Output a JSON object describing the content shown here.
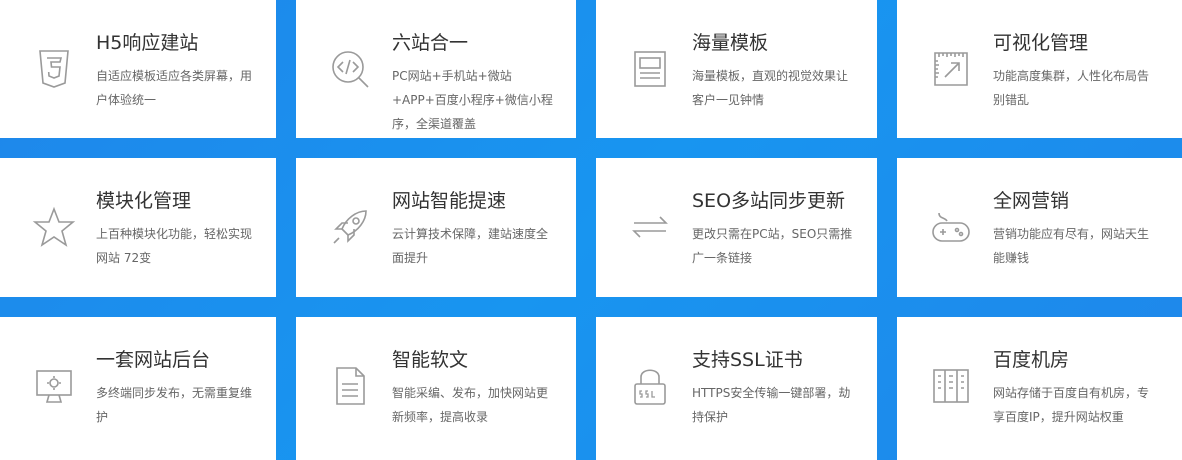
{
  "features": [
    {
      "icon": "html5-icon",
      "title": "H5响应建站",
      "desc": "自适应模板适应各类屏幕，用户体验统一"
    },
    {
      "icon": "code-search-icon",
      "title": "六站合一",
      "desc": "PC网站+手机站+微站+APP+百度小程序+微信小程序，全渠道覆盖"
    },
    {
      "icon": "template-icon",
      "title": "海量模板",
      "desc": "海量模板，直观的视觉效果让客户一见钟情"
    },
    {
      "icon": "ruler-arrow-icon",
      "title": "可视化管理",
      "desc": "功能高度集群，人性化布局告别错乱"
    },
    {
      "icon": "star-icon",
      "title": "模块化管理",
      "desc": "上百种模块化功能，轻松实现网站 72变"
    },
    {
      "icon": "rocket-icon",
      "title": "网站智能提速",
      "desc": "云计算技术保障，建站速度全面提升"
    },
    {
      "icon": "sync-arrows-icon",
      "title": "SEO多站同步更新",
      "desc": "更改只需在PC站，SEO只需推广一条链接"
    },
    {
      "icon": "gamepad-icon",
      "title": "全网营销",
      "desc": "营销功能应有尽有，网站天生能赚钱"
    },
    {
      "icon": "monitor-gear-icon",
      "title": "一套网站后台",
      "desc": "多终端同步发布，无需重复维护"
    },
    {
      "icon": "document-icon",
      "title": "智能软文",
      "desc": "智能采编、发布，加快网站更新频率，提高收录"
    },
    {
      "icon": "ssl-lock-icon",
      "title": "支持SSL证书",
      "desc": "HTTPS安全传输一键部署，劫持保护"
    },
    {
      "icon": "server-rack-icon",
      "title": "百度机房",
      "desc": "网站存储于百度自有机房，专享百度IP，提升网站权重"
    }
  ]
}
